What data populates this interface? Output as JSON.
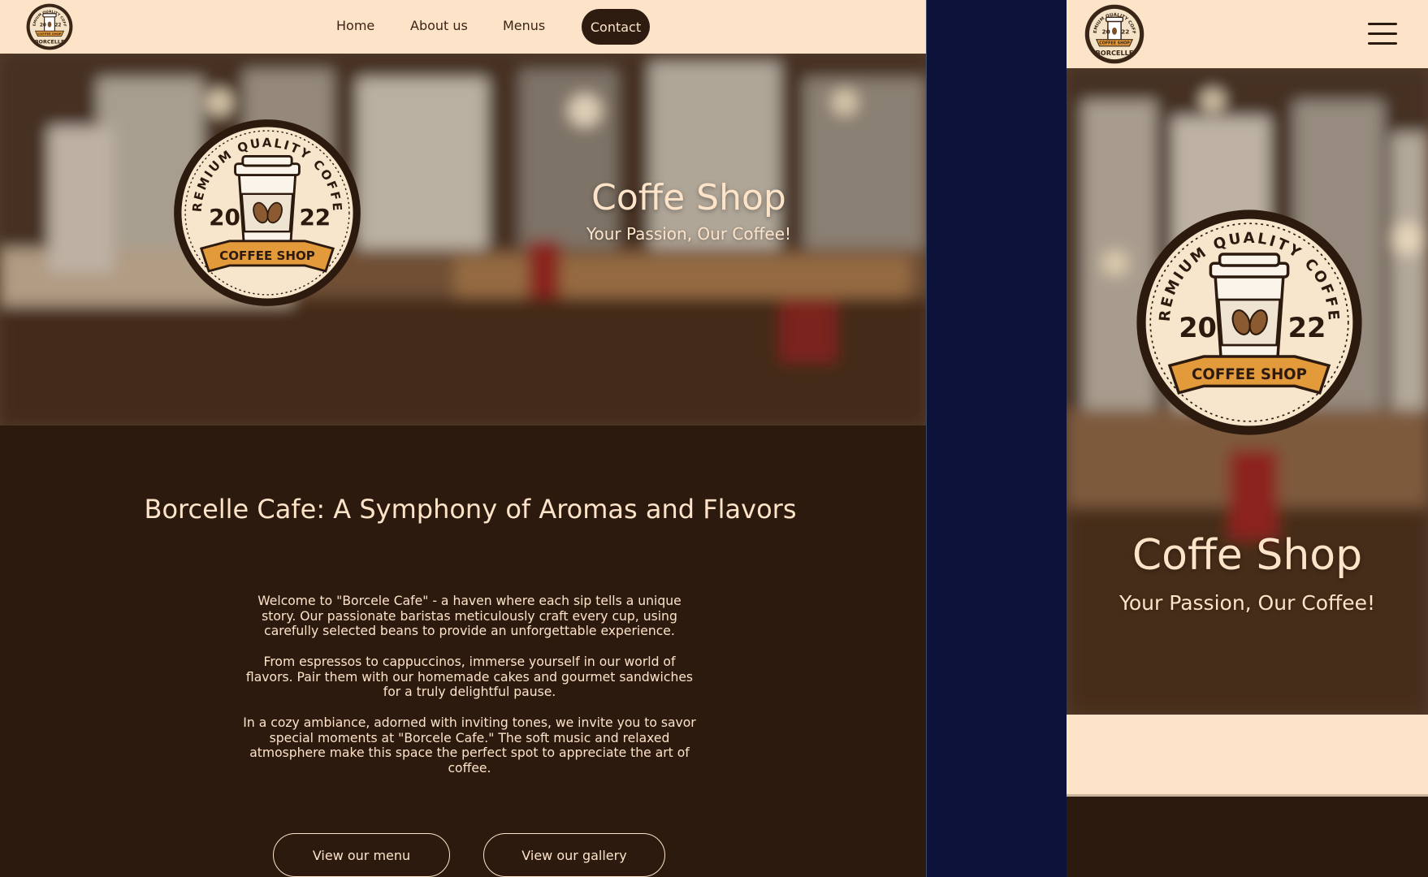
{
  "colors": {
    "cream": "#fde3c8",
    "espresso": "#2d1a0f",
    "navy_background": "#0c1239",
    "badge_orange": "#e39a3b"
  },
  "logo": {
    "small_top_text": "PREMIUM QUALITY COFFEE",
    "small_banner": "COFFEE SHOP",
    "small_bottom_text": "BORCELLE",
    "badge_arc_text": "PREMIUM QUALITY COFFEE",
    "year_left": "20",
    "year_right": "22",
    "banner_text": "COFFEE SHOP"
  },
  "desktop": {
    "nav": {
      "links": [
        "Home",
        "About us",
        "Menus"
      ],
      "contact_label": "Contact"
    },
    "hero": {
      "title": "Coffe Shop",
      "subtitle": "Your Passion, Our Coffee!"
    },
    "about": {
      "heading": "Borcelle Cafe: A Symphony of Aromas and Flavors",
      "paragraphs": [
        "Welcome to \"Borcele Cafe\" - a haven where each sip tells a unique story. Our passionate baristas meticulously craft every cup, using carefully selected beans to provide an unforgettable experience.",
        "From espressos to cappuccinos, immerse yourself in our world of flavors. Pair them with our homemade cakes and gourmet sandwiches for a truly delightful pause.",
        "In a cozy ambiance, adorned with inviting tones, we invite you to savor special moments at \"Borcele Cafe.\" The soft music and relaxed atmosphere make this space the perfect spot to appreciate the art of coffee."
      ],
      "buttons": [
        "View our menu",
        "View our gallery"
      ]
    }
  },
  "mobile": {
    "menu_icon": "hamburger-menu-icon",
    "hero": {
      "title": "Coffe Shop",
      "subtitle": "Your Passion, Our Coffee!"
    }
  }
}
